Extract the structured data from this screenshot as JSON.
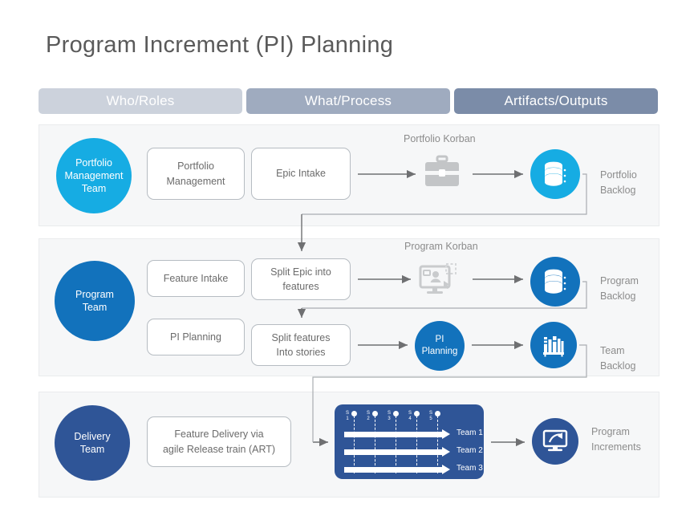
{
  "page": {
    "title": "Program Increment (PI) Planning"
  },
  "column_headers": [
    {
      "label": "Who/Roles",
      "color": "#ccd2dc"
    },
    {
      "label": "What/Process",
      "color": "#9fabbf"
    },
    {
      "label": "Artifacts/Outputs",
      "color": "#7b8ca8"
    }
  ],
  "rows": {
    "portfolio": {
      "role": {
        "label": "Portfolio\nManagement\nTeam",
        "line1": "Portfolio",
        "line2": "Management",
        "line3": "Team",
        "color": "#16ace3"
      },
      "process": [
        {
          "name": "portfolio-management",
          "line1": "Portfolio",
          "line2": "Management"
        },
        {
          "name": "epic-intake",
          "line1": "Epic Intake",
          "line2": ""
        }
      ],
      "tool": {
        "label": "Portfolio Korban",
        "icon": "briefcase-icon"
      },
      "artifact": {
        "icon": "database-icon",
        "line1": "Portfolio",
        "line2": "Backlog",
        "color": "#16ace3"
      }
    },
    "program": {
      "role": {
        "line1": "Program",
        "line2": "Team",
        "color": "#1272bc"
      },
      "process": [
        {
          "name": "feature-intake",
          "line1": "Feature Intake",
          "line2": ""
        },
        {
          "name": "split-epic-into-features",
          "line1": "Split Epic into",
          "line2": "features"
        },
        {
          "name": "pi-planning",
          "line1": "PI Planning",
          "line2": ""
        },
        {
          "name": "split-features-into-stories",
          "line1": "Split features",
          "line2": "Into stories"
        }
      ],
      "tool": {
        "label": "Program Korban",
        "icon": "monitor-user-icon"
      },
      "pi_circle": {
        "line1": "PI",
        "line2": "Planning",
        "color": "#1272bc"
      },
      "artifacts": [
        {
          "icon": "database-icon",
          "line1": "Program",
          "line2": "Backlog",
          "color": "#1272bc"
        },
        {
          "icon": "books-icon",
          "line1": "Team",
          "line2": "Backlog",
          "color": "#1272bc"
        }
      ]
    },
    "delivery": {
      "role": {
        "line1": "Delivery",
        "line2": "Team",
        "color": "#2f5597"
      },
      "process": [
        {
          "name": "feature-delivery-art",
          "line1": "Feature Delivery via",
          "line2": "agile Release train (ART)"
        }
      ],
      "art_board": {
        "sprints": [
          {
            "top": "S",
            "bottom": "1"
          },
          {
            "top": "S",
            "bottom": "2"
          },
          {
            "top": "S",
            "bottom": "3"
          },
          {
            "top": "S",
            "bottom": "4"
          },
          {
            "top": "S",
            "bottom": "5"
          }
        ],
        "teams": [
          "Team 1",
          "Team 2",
          "Team 3"
        ],
        "color": "#2f5597"
      },
      "artifact": {
        "icon": "monitor-arrow-icon",
        "line1": "Program",
        "line2": "Increments",
        "color": "#2f5597"
      }
    }
  },
  "colors": {
    "cyan": "#16ace3",
    "blue": "#1272bc",
    "navy": "#2f5597",
    "panel_bg": "#f6f7f8",
    "text_gray": "#6b6b6b",
    "label_gray": "#8c8c8c",
    "arrow_gray": "#6f7072"
  }
}
